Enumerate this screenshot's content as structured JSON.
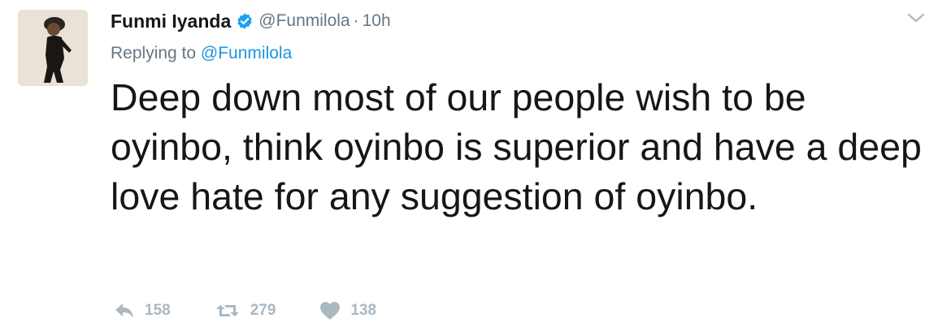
{
  "tweet": {
    "author_name": "Funmi Iyanda",
    "handle": "@Funmilola",
    "separator": "·",
    "time": "10h",
    "replying_prefix": "Replying to",
    "replying_to": "@Funmilola",
    "text": "Deep down most of our people wish to be oyinbo, think oyinbo is superior and have a deep love hate for any suggestion of oyinbo."
  },
  "actions": {
    "replies": "158",
    "retweets": "279",
    "likes": "138"
  },
  "colors": {
    "text": "#14171a",
    "secondary": "#657786",
    "link": "#1b95e0",
    "verified": "#1da1f2",
    "action_icon": "#aab8c2"
  },
  "icons": [
    "verified-badge-icon",
    "chevron-down-icon",
    "reply-icon",
    "retweet-icon",
    "heart-icon"
  ]
}
